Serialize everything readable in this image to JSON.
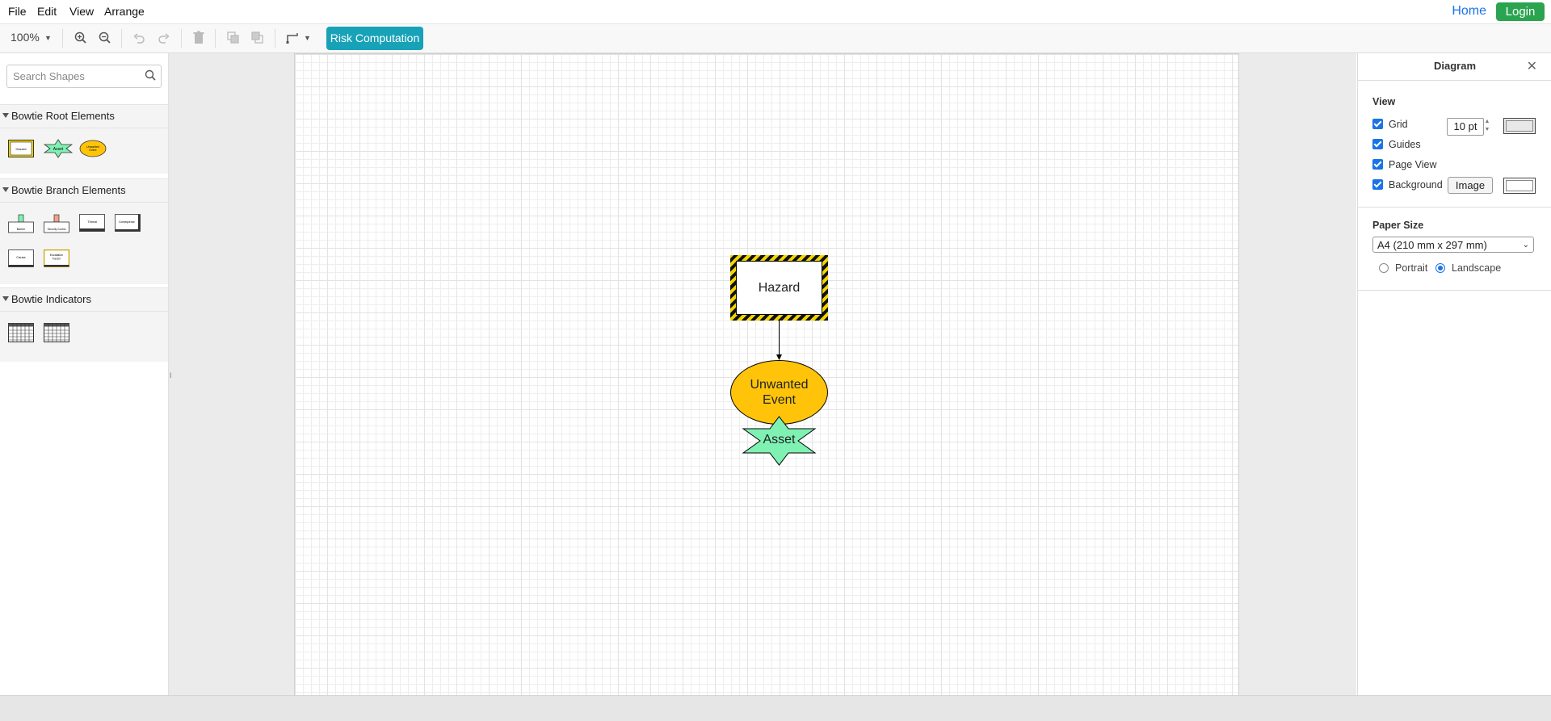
{
  "menubar": {
    "items": [
      "File",
      "Edit",
      "View",
      "Arrange"
    ],
    "home": "Home",
    "login": "Login"
  },
  "toolbar": {
    "zoom": "100%",
    "risk_button": "Risk Computation"
  },
  "sidebar": {
    "search_placeholder": "Search Shapes",
    "sections": [
      {
        "title": "Bowtie Root Elements",
        "shapes": [
          "Hazard",
          "Asset",
          "Unwanted Event"
        ]
      },
      {
        "title": "Bowtie Branch Elements",
        "shapes": [
          "Barrier",
          "Security Control",
          "Threat",
          "Consequence",
          "Cause",
          "Escalation Factor"
        ]
      },
      {
        "title": "Bowtie Indicators",
        "shapes": [
          "Indicator Table 1",
          "Indicator Table 2"
        ]
      }
    ]
  },
  "diagram": {
    "hazard": "Hazard",
    "unwanted_event": "Unwanted Event",
    "asset": "Asset",
    "colors": {
      "hazard_stripe": "#f2d500",
      "unwanted_fill": "#ffc40a",
      "asset_fill": "#7ff2b3"
    }
  },
  "format_panel": {
    "title": "Diagram",
    "view_title": "View",
    "grid": "Grid",
    "grid_size": "10 pt",
    "guides": "Guides",
    "page_view": "Page View",
    "background": "Background",
    "image_button": "Image",
    "paper_title": "Paper Size",
    "paper_size": "A4 (210 mm x 297 mm)",
    "portrait": "Portrait",
    "landscape": "Landscape",
    "orientation": "Landscape"
  }
}
